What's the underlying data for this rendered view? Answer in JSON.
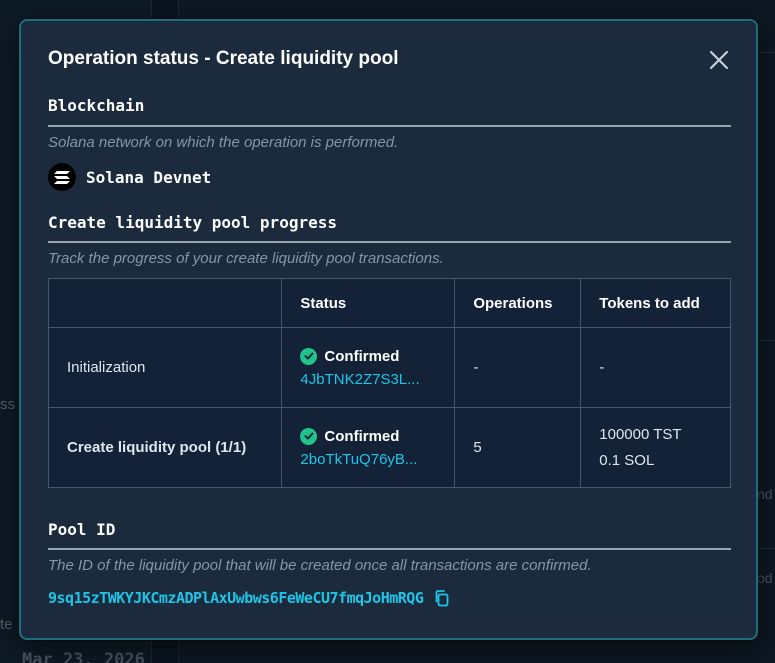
{
  "background": {
    "left_fragment": "ss",
    "left_fragment2": "te",
    "date": "Mar 23, 2026",
    "right_fragment1": "nd",
    "right_fragment2": "od"
  },
  "modal": {
    "title": "Operation status - Create liquidity pool",
    "close_icon": "close-icon"
  },
  "blockchain": {
    "heading": "Blockchain",
    "description": "Solana network on which the operation is performed.",
    "network": "Solana Devnet",
    "network_icon": "solana-logo-icon"
  },
  "progress": {
    "heading": "Create liquidity pool progress",
    "description": "Track the progress of your create liquidity pool transactions.",
    "columns": [
      "",
      "Status",
      "Operations",
      "Tokens to add"
    ],
    "rows": [
      {
        "step": "Initialization",
        "status": "Confirmed",
        "tx": "4JbTNK2Z7S3L...",
        "operations": "-",
        "tokens": [
          "-"
        ]
      },
      {
        "step": "Create liquidity pool (1/1)",
        "status": "Confirmed",
        "tx": "2boTkTuQ76yB...",
        "operations": "5",
        "tokens": [
          "100000 TST",
          "0.1 SOL"
        ]
      }
    ]
  },
  "pool": {
    "heading": "Pool ID",
    "description": "The ID of the liquidity pool that will be created once all transactions are confirmed.",
    "id": "9sq15zTWKYJKCmzADPlAxUwbws6FeWeCU7fmqJoHmRQG",
    "copy_icon": "copy-icon"
  },
  "colors": {
    "modal_bg": "#1b2a3c",
    "modal_border": "#1c6f7d",
    "accent_link": "#1fc4e6",
    "confirmed_green": "#22c38a"
  }
}
